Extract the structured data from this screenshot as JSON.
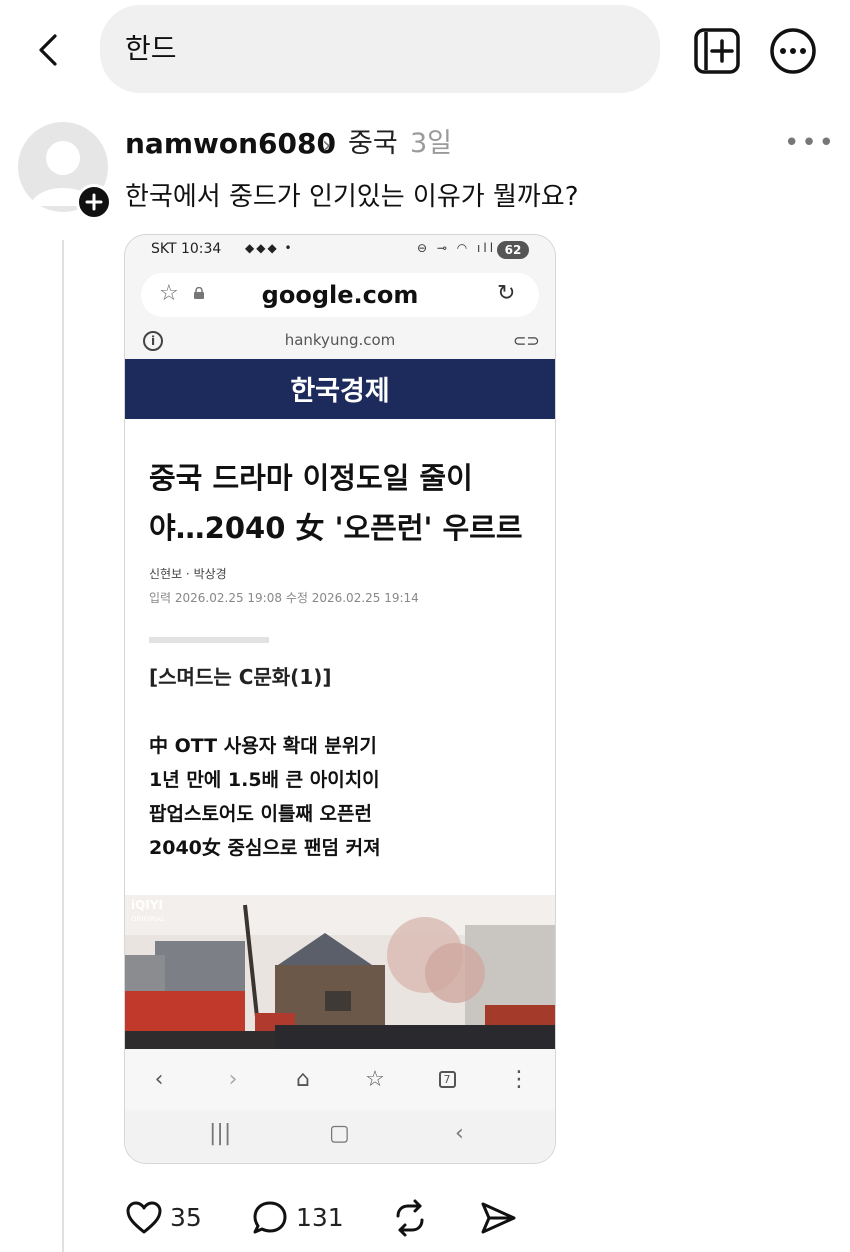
{
  "header": {
    "search_text": "한드",
    "icons": [
      "back-arrow-icon",
      "new-post-icon",
      "more-options-icon"
    ]
  },
  "post": {
    "username": "namwon6080",
    "topic": "중국",
    "time": "3일",
    "text": "한국에서 중드가 인기있는 이유가 뭘까요?",
    "likes": "35",
    "replies": "131"
  },
  "screenshot": {
    "status_time": "SKT 10:34",
    "battery": "62",
    "url": "google.com",
    "site": "hankyung.com",
    "masthead": "한국경제",
    "headline_line1": "중국 드라마 이정도일 줄이",
    "headline_line2": "야…2040 女 '오픈런' 우르르",
    "byline": "신현보 · 박상경",
    "dates": "입력 2026.02.25 19:08 수정 2026.02.25 19:14",
    "series": "[스며드는 C문화(1)]",
    "summary": [
      "中 OTT 사용자 확대 분위기",
      "1년 만에 1.5배 큰 아이치이",
      "팝업스토어도 이틀째 오픈런",
      "2040女 중심으로 팬덤 커져"
    ],
    "photo_logo": "iQIYI",
    "photo_logo_sub": "ORIGINAL",
    "tabs_count": "7"
  },
  "colors": {
    "masthead_bg": "#1d2b5c",
    "search_bg": "#f0f0f0"
  }
}
